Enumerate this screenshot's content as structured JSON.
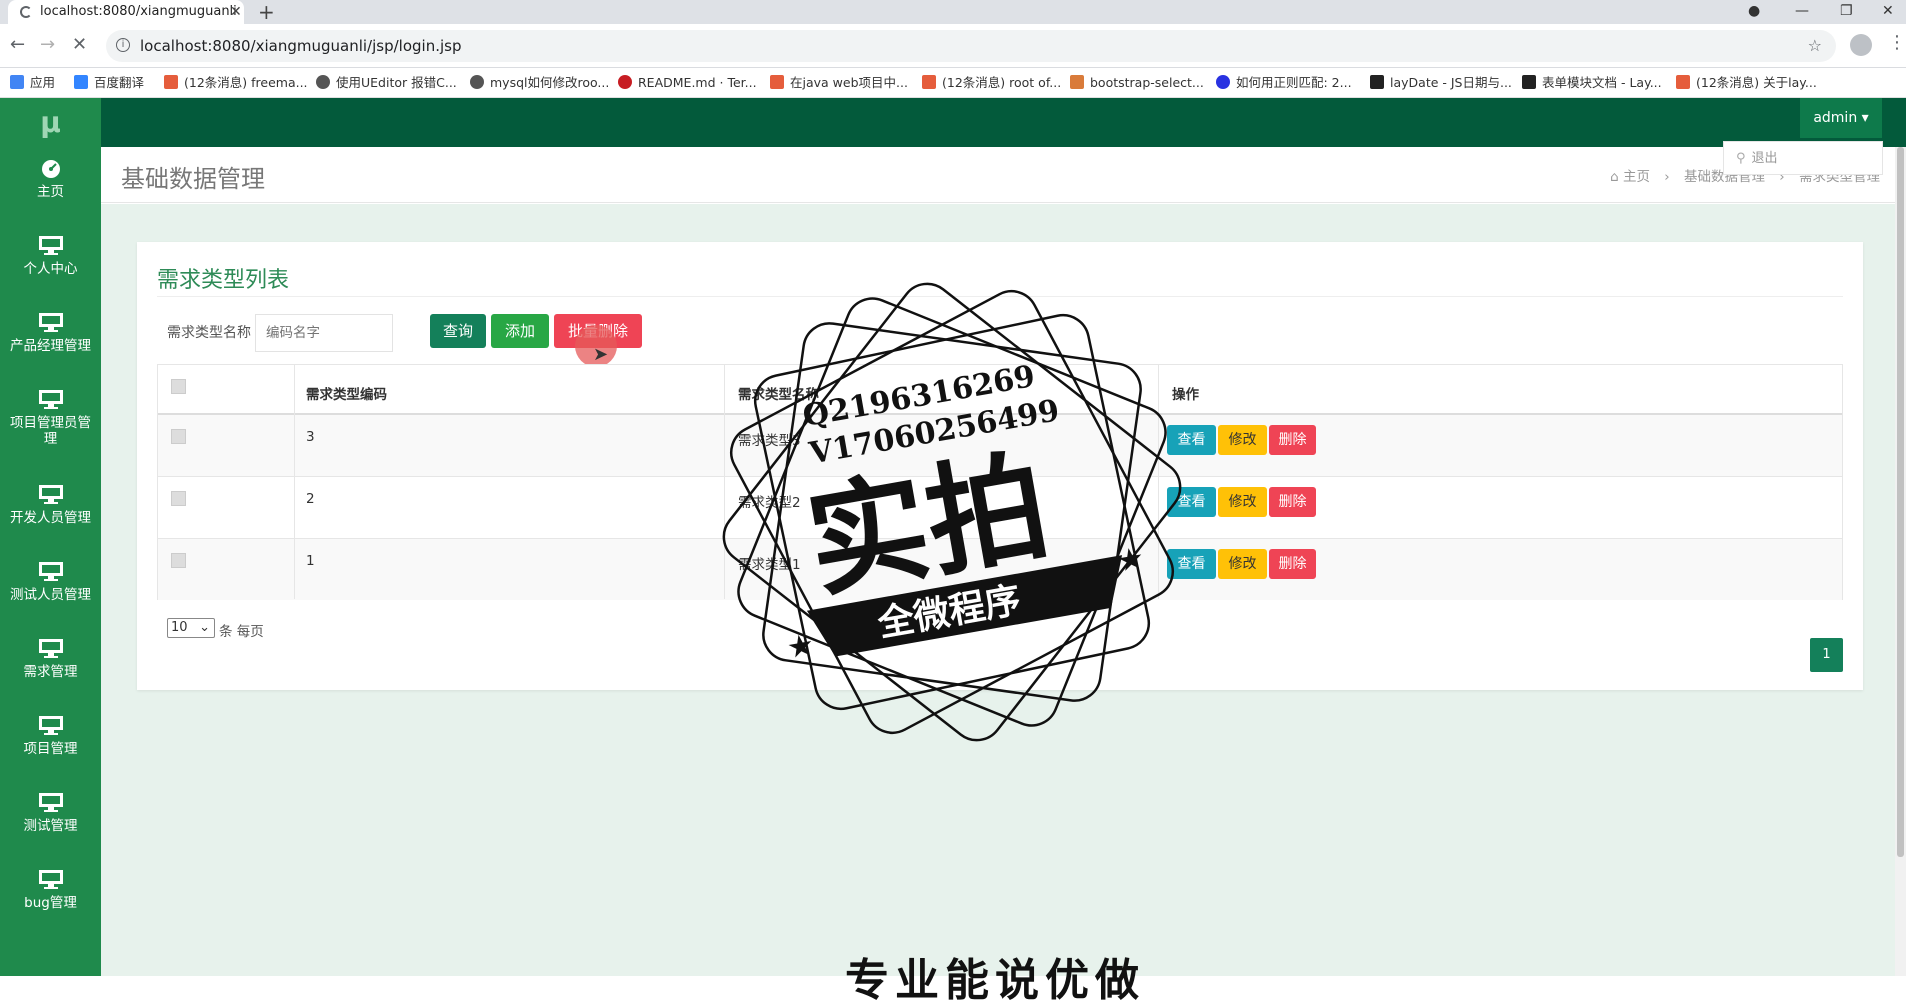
{
  "browser": {
    "tab_title": "localhost:8080/xiangmuguanli",
    "tab_close": "✕",
    "new_tab": "+",
    "url": "localhost:8080/xiangmuguanli/jsp/login.jsp",
    "bookmarks": [
      "应用",
      "百度翻译",
      "(12条消息) freema...",
      "使用UEditor 报错C...",
      "mysql如何修改roo...",
      "README.md · Ter...",
      "在java web项目中...",
      "(12条消息) root of...",
      "bootstrap-select...",
      "如何用正则匹配: 2...",
      "layDate - JS日期与...",
      "表单模块文档 - Lay...",
      "(12条消息) 关于lay..."
    ]
  },
  "app": {
    "logo": "μ",
    "user": "admin ▾",
    "logout": "退出",
    "page_title": "基础数据管理",
    "breadcrumb": [
      "主页",
      "基础数据管理",
      "需求类型管理"
    ],
    "sidebar": [
      {
        "label": "主页",
        "icon": "dashboard-icon"
      },
      {
        "label": "个人中心",
        "icon": "monitor-icon"
      },
      {
        "label": "产品经理管理",
        "icon": "monitor-icon"
      },
      {
        "label": "项目管理员管理",
        "icon": "monitor-icon"
      },
      {
        "label": "开发人员管理",
        "icon": "monitor-icon"
      },
      {
        "label": "测试人员管理",
        "icon": "monitor-icon"
      },
      {
        "label": "需求管理",
        "icon": "monitor-icon"
      },
      {
        "label": "项目管理",
        "icon": "monitor-icon"
      },
      {
        "label": "测试管理",
        "icon": "monitor-icon"
      },
      {
        "label": "bug管理",
        "icon": "monitor-icon"
      }
    ]
  },
  "card": {
    "title": "需求类型列表",
    "search_label": "需求类型名称",
    "search_placeholder": "编码名字",
    "btn_query": "查询",
    "btn_add": "添加",
    "btn_batch_delete": "批量删除",
    "columns": [
      "需求类型编码",
      "需求类型名称",
      "操作"
    ],
    "rows": [
      {
        "code": "3",
        "name": "需求类型3"
      },
      {
        "code": "2",
        "name": "需求类型2"
      },
      {
        "code": "1",
        "name": "需求类型1"
      }
    ],
    "actions": {
      "view": "查看",
      "edit": "修改",
      "delete": "删除"
    },
    "page_size": "10",
    "page_size_suffix": "条 每页",
    "current_page": "1"
  },
  "watermark": {
    "line1": "Q2196316269",
    "line2": "V17060256499",
    "main": "实拍",
    "banner": "全微程序"
  },
  "bottom_text": "专业能说优做"
}
